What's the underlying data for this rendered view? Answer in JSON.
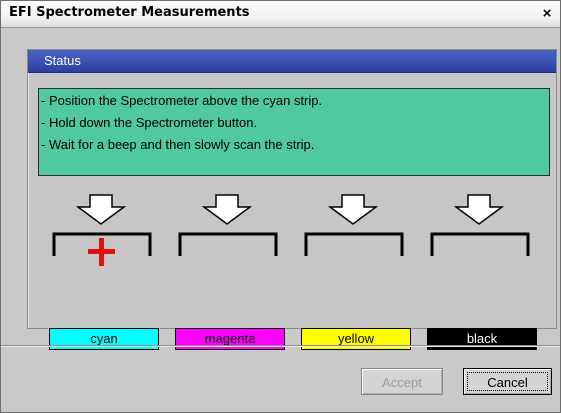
{
  "window": {
    "title": "EFI Spectrometer Measurements",
    "close_label": "×"
  },
  "status": {
    "header": "Status",
    "lines": [
      "Position the Spectrometer above the cyan strip.",
      "Hold down the Spectrometer button.",
      "Wait for a beep and then slowly scan the strip."
    ],
    "line_prefix": "-"
  },
  "strips": [
    {
      "label": "cyan",
      "color": "#00ffff",
      "text_color": "#000000",
      "active": true
    },
    {
      "label": "magenta",
      "color": "#ff00ff",
      "text_color": "#000000",
      "active": false
    },
    {
      "label": "yellow",
      "color": "#ffff00",
      "text_color": "#000000",
      "active": false
    },
    {
      "label": "black",
      "color": "#000000",
      "text_color": "#ffffff",
      "active": false
    }
  ],
  "buttons": {
    "accept_label": "Accept",
    "accept_enabled": false,
    "cancel_label": "Cancel"
  },
  "colors": {
    "header_blue": "#2a3f9e",
    "message_bg": "#50c8a0",
    "crosshair_red": "#e01010"
  },
  "icons": {
    "arrow": "down-arrow-outline-icon",
    "bracket": "strip-bracket-icon",
    "crosshair": "red-cross-icon"
  }
}
